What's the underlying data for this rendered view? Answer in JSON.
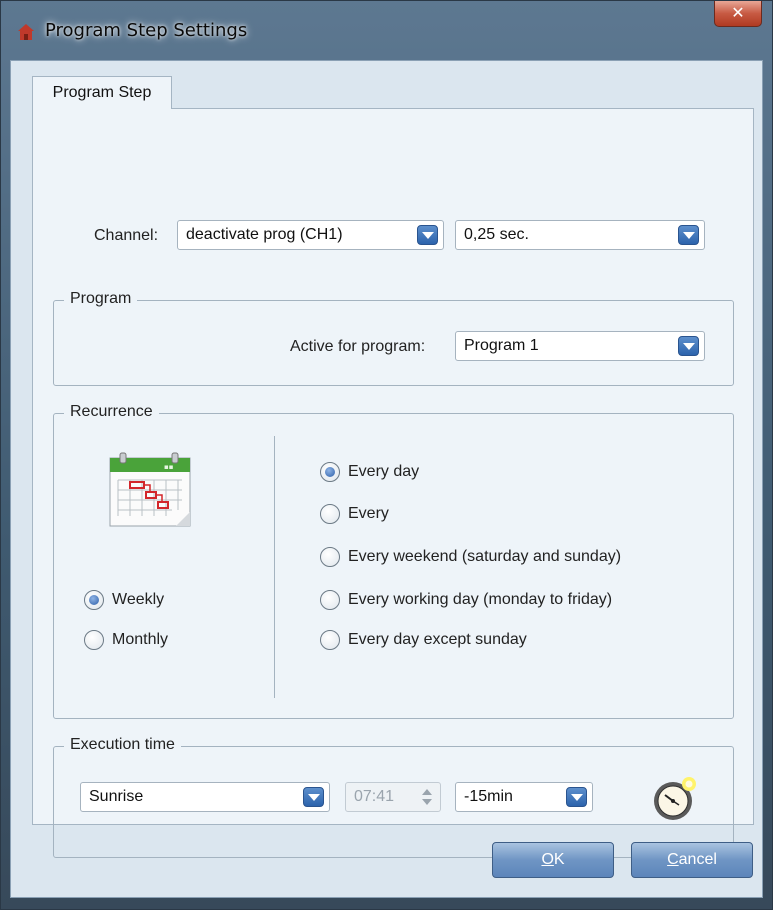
{
  "window": {
    "title": "Program Step Settings",
    "close_symbol": "✕"
  },
  "tabs": [
    {
      "label": "Program Step",
      "active": true
    }
  ],
  "channel": {
    "label": "Channel:",
    "value": "deactivate prog (CH1)",
    "duration": "0,25 sec."
  },
  "program_group": {
    "title": "Program",
    "label": "Active for program:",
    "value": "Program 1"
  },
  "recurrence": {
    "title": "Recurrence",
    "icon": "calendar-icon",
    "modes": [
      {
        "label": "Weekly",
        "checked": true
      },
      {
        "label": "Monthly",
        "checked": false
      }
    ],
    "options": [
      {
        "label": "Every day",
        "checked": true
      },
      {
        "label": "Every",
        "checked": false
      },
      {
        "label": "Every weekend (saturday and sunday)",
        "checked": false
      },
      {
        "label": "Every working day (monday to friday)",
        "checked": false
      },
      {
        "label": "Every day except sunday",
        "checked": false
      }
    ]
  },
  "execution": {
    "title": "Execution time",
    "mode": "Sunrise",
    "time": "07:41",
    "offset": "-15min",
    "icon": "clock-icon"
  },
  "buttons": {
    "ok_mnemonic": "O",
    "ok_rest": "K",
    "cancel_mnemonic": "C",
    "cancel_rest": "ancel"
  },
  "colors": {
    "accent": "#2c63ac",
    "title_icon": "#c0392b",
    "calendar_green": "#4aa33a"
  }
}
